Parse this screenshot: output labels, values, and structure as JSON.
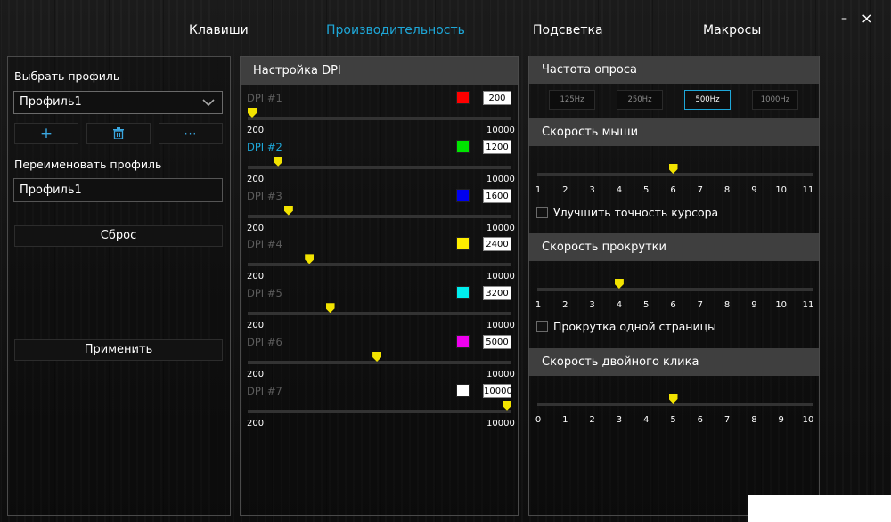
{
  "nav": {
    "tabs": [
      {
        "label": "Клавиши"
      },
      {
        "label": "Производительность"
      },
      {
        "label": "Подсветка"
      },
      {
        "label": "Макросы"
      }
    ],
    "active_index": 1,
    "minimize_label": "–",
    "close_label": "×"
  },
  "profile": {
    "select_label": "Выбрать профиль",
    "selected": "Профиль1",
    "add_label": "+",
    "delete_label": "🗑",
    "more_label": "···",
    "rename_label": "Переименовать профиль",
    "rename_value": "Профиль1",
    "reset_label": "Сброс",
    "apply_label": "Применить"
  },
  "dpi": {
    "title": "Настройка DPI",
    "min_label": "200",
    "max_label": "10000",
    "min": 200,
    "max": 10000,
    "levels": [
      {
        "label": "DPI #1",
        "value": "200",
        "num": 200,
        "color": "#ff0000",
        "active": false
      },
      {
        "label": "DPI #2",
        "value": "1200",
        "num": 1200,
        "color": "#00e400",
        "active": true
      },
      {
        "label": "DPI #3",
        "value": "1600",
        "num": 1600,
        "color": "#0000ee",
        "active": false
      },
      {
        "label": "DPI #4",
        "value": "2400",
        "num": 2400,
        "color": "#ffee00",
        "active": false
      },
      {
        "label": "DPI #5",
        "value": "3200",
        "num": 3200,
        "color": "#00eeee",
        "active": false
      },
      {
        "label": "DPI #6",
        "value": "5000",
        "num": 5000,
        "color": "#ee00ee",
        "active": false
      },
      {
        "label": "DPI #7",
        "value": "10000",
        "num": 10000,
        "color": "#ffffff",
        "active": false
      }
    ]
  },
  "polling": {
    "title": "Частота опроса",
    "options": [
      "125Hz",
      "250Hz",
      "500Hz",
      "1000Hz"
    ],
    "selected_index": 2
  },
  "mouse_speed": {
    "title": "Скорость мыши",
    "ticks": [
      "1",
      "2",
      "3",
      "4",
      "5",
      "6",
      "7",
      "8",
      "9",
      "10",
      "11"
    ],
    "min": 1,
    "max": 11,
    "value": 6,
    "checkbox_label": "Улучшить точность курсора",
    "checkbox_checked": false
  },
  "scroll_speed": {
    "title": "Скорость прокрутки",
    "ticks": [
      "1",
      "2",
      "3",
      "4",
      "5",
      "6",
      "7",
      "8",
      "9",
      "10",
      "11"
    ],
    "min": 1,
    "max": 11,
    "value": 4,
    "checkbox_label": "Прокрутка одной страницы",
    "checkbox_checked": false
  },
  "double_click": {
    "title": "Скорость двойного клика",
    "ticks": [
      "0",
      "1",
      "2",
      "3",
      "4",
      "5",
      "6",
      "7",
      "8",
      "9",
      "10"
    ],
    "min": 0,
    "max": 10,
    "value": 5
  },
  "colors": {
    "accent": "#1ea7d8",
    "thumb": "#f2e300"
  }
}
